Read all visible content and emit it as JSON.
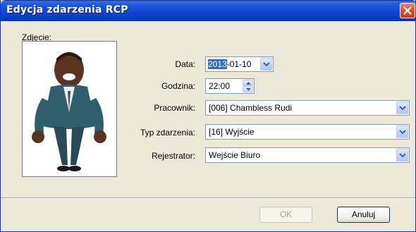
{
  "window": {
    "title": "Edycja zdarzenia RCP"
  },
  "photo": {
    "label": "Zdjęcie:"
  },
  "form": {
    "date": {
      "label": "Data:",
      "value_selected": "2013",
      "value_rest": "-01-10"
    },
    "time": {
      "label": "Godzina:",
      "value": "22:00"
    },
    "employee": {
      "label": "Pracownik:",
      "value": "[006]  Chambless Rudi"
    },
    "event_type": {
      "label": "Typ zdarzenia:",
      "value": "[16]  Wyjście"
    },
    "recorder": {
      "label": "Rejestrator:",
      "value": "Wejście Biuro"
    }
  },
  "buttons": {
    "ok": "OK",
    "cancel": "Anuluj"
  },
  "icons": {
    "close": "close-icon",
    "dropdown": "chevron-down-icon",
    "spin_up": "spin-up-icon",
    "spin_down": "spin-down-icon"
  },
  "colors": {
    "titlebar": "#0f48d4",
    "dialog_bg": "#ece9d8",
    "selection": "#316ac5",
    "field_border": "#7f9db9"
  }
}
